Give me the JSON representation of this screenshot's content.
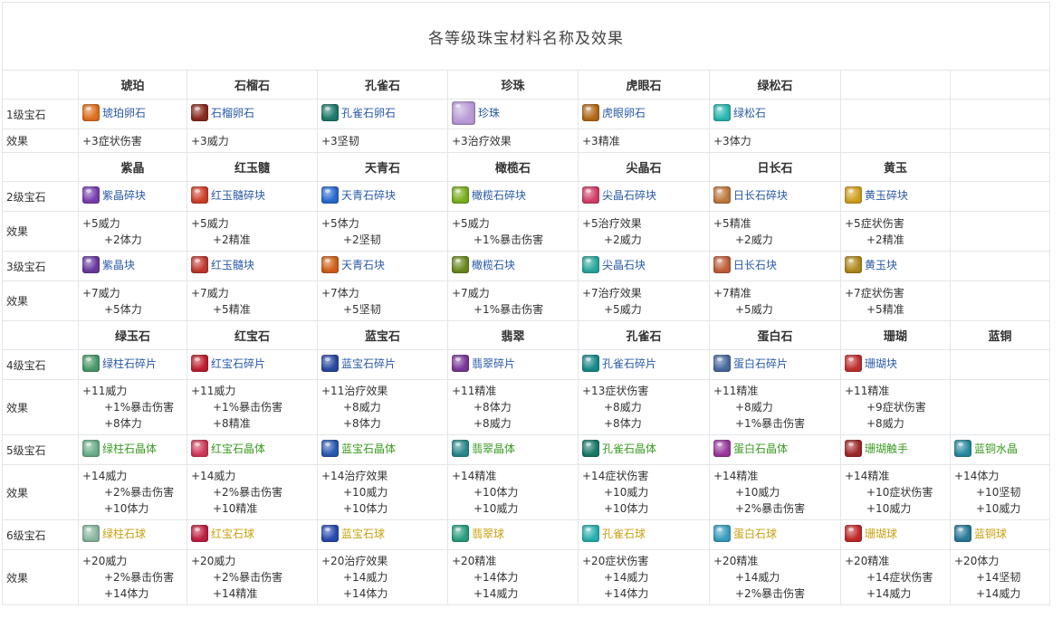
{
  "title": "各等级珠宝材料名称及效果",
  "effect_label": "效果",
  "sections": [
    {
      "header": [
        "琥珀",
        "石榴石",
        "孔雀石",
        "珍珠",
        "虎眼石",
        "绿松石",
        "",
        ""
      ],
      "tiers": [
        {
          "label": "1级宝石",
          "gems": [
            {
              "name": "琥珀卵石",
              "color": "blue",
              "icon": "#e07020"
            },
            {
              "name": "石榴卵石",
              "color": "blue",
              "icon": "#8a2a20"
            },
            {
              "name": "孔雀石卵石",
              "color": "blue",
              "icon": "#1f7a6a"
            },
            {
              "name": "珍珠",
              "color": "blue",
              "icon": "#b79ad6"
            },
            {
              "name": "虎眼卵石",
              "color": "blue",
              "icon": "#b36a1a"
            },
            {
              "name": "绿松石",
              "color": "blue",
              "icon": "#2ab8b0"
            },
            null,
            null
          ],
          "effects": [
            [
              "+3症状伤害"
            ],
            [
              "+3威力"
            ],
            [
              "+3坚韧"
            ],
            [
              "+3治疗效果"
            ],
            [
              "+3精准"
            ],
            [
              "+3体力"
            ],
            [],
            []
          ]
        }
      ]
    },
    {
      "header": [
        "紫晶",
        "红玉髓",
        "天青石",
        "橄榄石",
        "尖晶石",
        "日长石",
        "黄玉",
        ""
      ],
      "tiers": [
        {
          "label": "2级宝石",
          "gems": [
            {
              "name": "紫晶碎块",
              "color": "blue",
              "icon": "#7a3fb0"
            },
            {
              "name": "红玉髓碎块",
              "color": "blue",
              "icon": "#d0402a"
            },
            {
              "name": "天青石碎块",
              "color": "blue",
              "icon": "#2a6ad0"
            },
            {
              "name": "橄榄石碎块",
              "color": "blue",
              "icon": "#7ab020"
            },
            {
              "name": "尖晶石碎块",
              "color": "blue",
              "icon": "#d0406a"
            },
            {
              "name": "日长石碎块",
              "color": "blue",
              "icon": "#c07a40"
            },
            {
              "name": "黄玉碎块",
              "color": "blue",
              "icon": "#d0a020"
            },
            null
          ],
          "effects": [
            [
              "+5威力",
              "+2体力"
            ],
            [
              "+5威力",
              "+2精准"
            ],
            [
              "+5体力",
              "+2坚韧"
            ],
            [
              "+5威力",
              "+1%暴击伤害"
            ],
            [
              "+5治疗效果",
              "+2威力"
            ],
            [
              "+5精准",
              "+2威力"
            ],
            [
              "+5症状伤害",
              "+2精准"
            ],
            []
          ]
        },
        {
          "label": "3级宝石",
          "gems": [
            {
              "name": "紫晶块",
              "color": "blue",
              "icon": "#6a3aa0"
            },
            {
              "name": "红玉髓块",
              "color": "blue",
              "icon": "#c03a30"
            },
            {
              "name": "天青石块",
              "color": "blue",
              "icon": "#d0601a"
            },
            {
              "name": "橄榄石块",
              "color": "blue",
              "icon": "#6a8a20"
            },
            {
              "name": "尖晶石块",
              "color": "blue",
              "icon": "#2aa8a0"
            },
            {
              "name": "日长石块",
              "color": "blue",
              "icon": "#c0603a"
            },
            {
              "name": "黄玉块",
              "color": "blue",
              "icon": "#b08a20"
            },
            null
          ],
          "effects": [
            [
              "+7威力",
              "+5体力"
            ],
            [
              "+7威力",
              "+5精准"
            ],
            [
              "+7体力",
              "+5坚韧"
            ],
            [
              "+7威力",
              "+1%暴击伤害"
            ],
            [
              "+7治疗效果",
              "+5威力"
            ],
            [
              "+7精准",
              "+5威力"
            ],
            [
              "+7症状伤害",
              "+5精准"
            ],
            []
          ]
        }
      ]
    },
    {
      "header": [
        "绿玉石",
        "红宝石",
        "蓝宝石",
        "翡翠",
        "孔雀石",
        "蛋白石",
        "珊瑚",
        "蓝铜"
      ],
      "tiers": [
        {
          "label": "4级宝石",
          "gems": [
            {
              "name": "绿柱石碎片",
              "color": "blue",
              "icon": "#4a9a6a"
            },
            {
              "name": "红宝石碎片",
              "color": "blue",
              "icon": "#c02030"
            },
            {
              "name": "蓝宝石碎片",
              "color": "blue",
              "icon": "#2a4aa0"
            },
            {
              "name": "翡翠碎片",
              "color": "blue",
              "icon": "#7a3a9a"
            },
            {
              "name": "孔雀石碎片",
              "color": "blue",
              "icon": "#1a8a8a"
            },
            {
              "name": "蛋白石碎片",
              "color": "blue",
              "icon": "#4a6aa0"
            },
            {
              "name": "珊瑚块",
              "color": "blue",
              "icon": "#c03030"
            },
            null
          ],
          "effects": [
            [
              "+11威力",
              "+1%暴击伤害",
              "+8体力"
            ],
            [
              "+11威力",
              "+1%暴击伤害",
              "+8精准"
            ],
            [
              "+11治疗效果",
              "+8威力",
              "+8体力"
            ],
            [
              "+11精准",
              "+8体力",
              "+8威力"
            ],
            [
              "+13症状伤害",
              "+8威力",
              "+8体力"
            ],
            [
              "+11精准",
              "+8威力",
              "+1%暴击伤害"
            ],
            [
              "+11精准",
              "+9症状伤害",
              "+8威力"
            ],
            []
          ]
        },
        {
          "label": "5级宝石",
          "gems": [
            {
              "name": "绿柱石晶体",
              "color": "green",
              "icon": "#6ab08a"
            },
            {
              "name": "红宝石晶体",
              "color": "green",
              "icon": "#d03a5a"
            },
            {
              "name": "蓝宝石晶体",
              "color": "green",
              "icon": "#2a5ab0"
            },
            {
              "name": "翡翠晶体",
              "color": "green",
              "icon": "#2a8a8a"
            },
            {
              "name": "孔雀石晶体",
              "color": "green",
              "icon": "#1a7a6a"
            },
            {
              "name": "蛋白石晶体",
              "color": "green",
              "icon": "#9a3aa0"
            },
            {
              "name": "珊瑚触手",
              "color": "green",
              "icon": "#a02a2a"
            },
            {
              "name": "蓝铜水晶",
              "color": "green",
              "icon": "#2a8aa0"
            }
          ],
          "effects": [
            [
              "+14威力",
              "+2%暴击伤害",
              "+10体力"
            ],
            [
              "+14威力",
              "+2%暴击伤害",
              "+10精准"
            ],
            [
              "+14治疗效果",
              "+10威力",
              "+10体力"
            ],
            [
              "+14精准",
              "+10体力",
              "+10威力"
            ],
            [
              "+14症状伤害",
              "+10威力",
              "+10体力"
            ],
            [
              "+14精准",
              "+10威力",
              "+2%暴击伤害"
            ],
            [
              "+14精准",
              "+10症状伤害",
              "+10威力"
            ],
            [
              "+14体力",
              "+10坚韧",
              "+10威力"
            ]
          ]
        },
        {
          "label": "6级宝石",
          "gems": [
            {
              "name": "绿柱石球",
              "color": "yellow",
              "icon": "#8ab8a0"
            },
            {
              "name": "红宝石球",
              "color": "yellow",
              "icon": "#c02040"
            },
            {
              "name": "蓝宝石球",
              "color": "yellow",
              "icon": "#2a4ab0"
            },
            {
              "name": "翡翠球",
              "color": "yellow",
              "icon": "#2aa080"
            },
            {
              "name": "孔雀石球",
              "color": "yellow",
              "icon": "#2ab0b0"
            },
            {
              "name": "蛋白石球",
              "color": "yellow",
              "icon": "#3aa0c0"
            },
            {
              "name": "珊瑚球",
              "color": "yellow",
              "icon": "#c02a2a"
            },
            {
              "name": "蓝铜球",
              "color": "yellow",
              "icon": "#2a7a9a"
            }
          ],
          "effects": [
            [
              "+20威力",
              "+2%暴击伤害",
              "+14体力"
            ],
            [
              "+20威力",
              "+2%暴击伤害",
              "+14精准"
            ],
            [
              "+20治疗效果",
              "+14威力",
              "+14体力"
            ],
            [
              "+20精准",
              "+14体力",
              "+14威力"
            ],
            [
              "+20症状伤害",
              "+14威力",
              "+14体力"
            ],
            [
              "+20精准",
              "+14威力",
              "+2%暴击伤害"
            ],
            [
              "+20精准",
              "+14症状伤害",
              "+14威力"
            ],
            [
              "+20体力",
              "+14坚韧",
              "+14威力"
            ]
          ]
        }
      ]
    }
  ]
}
